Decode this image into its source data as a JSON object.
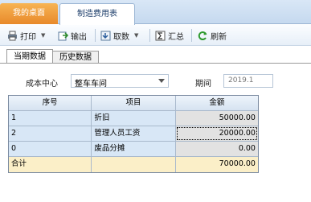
{
  "tabs": {
    "home": "我的桌面",
    "active": "制造费用表"
  },
  "toolbar": {
    "print": "打印",
    "export": "输出",
    "fetch": "取数",
    "summary": "汇总",
    "refresh": "刷新"
  },
  "subtabs": {
    "current": "当期数据",
    "history": "历史数据"
  },
  "form": {
    "cost_center_label": "成本中心",
    "cost_center_value": "整车车间",
    "period_label": "期间",
    "period_value": "2019.1"
  },
  "grid": {
    "headers": [
      "序号",
      "项目",
      "金额"
    ],
    "rows": [
      {
        "no": "1",
        "item": "折旧",
        "amount": "50000.00"
      },
      {
        "no": "2",
        "item": "管理人员工资",
        "amount": "20000.00"
      },
      {
        "no": "0",
        "item": "废品分摊",
        "amount": "0.00"
      }
    ],
    "total": {
      "label": "合计",
      "item": "",
      "amount": "70000.00"
    }
  }
}
